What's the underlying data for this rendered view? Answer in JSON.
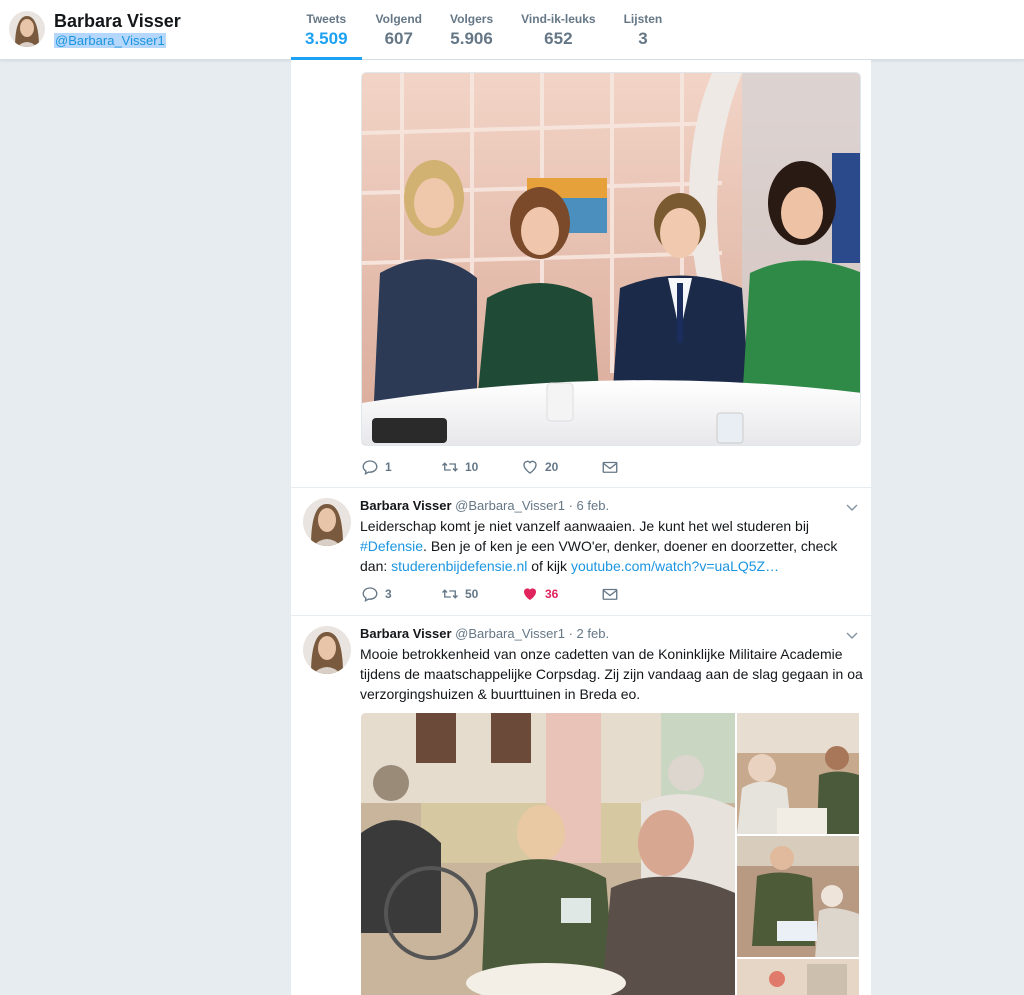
{
  "profile": {
    "name": "Barbara Visser",
    "handle": "@Barbara_Visser1"
  },
  "stats": [
    {
      "label": "Tweets",
      "value": "3.509",
      "active": true
    },
    {
      "label": "Volgend",
      "value": "607"
    },
    {
      "label": "Volgers",
      "value": "5.906"
    },
    {
      "label": "Vind-ik-leuks",
      "value": "652"
    },
    {
      "label": "Lijsten",
      "value": "3"
    }
  ],
  "tweets": [
    {
      "actions": {
        "replies": "1",
        "retweets": "10",
        "likes": "20"
      }
    },
    {
      "name": "Barbara Visser",
      "handle": "@Barbara_Visser1",
      "date": "· 6 feb.",
      "text_part1": "Leiderschap komt je niet vanzelf aanwaaien. Je kunt het wel studeren bij ",
      "hashtag": "#Defensie",
      "text_part2": ". Ben je of ken je een VWO'er, denker, doener en doorzetter, check dan: ",
      "link1": "studerenbijdefensie.nl",
      "text_part3": " of kijk ",
      "link2": "youtube.com/watch?v=uaLQ5Z…",
      "actions": {
        "replies": "3",
        "retweets": "50",
        "likes": "36",
        "liked": true
      }
    },
    {
      "name": "Barbara Visser",
      "handle": "@Barbara_Visser1",
      "date": "· 2 feb.",
      "text": "Mooie betrokkenheid van onze cadetten van de Koninklijke Militaire Academie tijdens de maatschappelijke Corpsdag. Zij zijn vandaag aan de slag gegaan in oa verzorgingshuizen & buurttuinen in Breda eo."
    }
  ],
  "icons": {
    "reply": "reply-icon",
    "retweet": "retweet-icon",
    "like": "heart-icon",
    "dm": "envelope-icon",
    "caret": "chevron-down-icon"
  },
  "colors": {
    "accent": "#1da1f2",
    "link": "#1b95e0",
    "like": "#e0245e",
    "muted": "#657786",
    "background": "#e6ecf0"
  }
}
